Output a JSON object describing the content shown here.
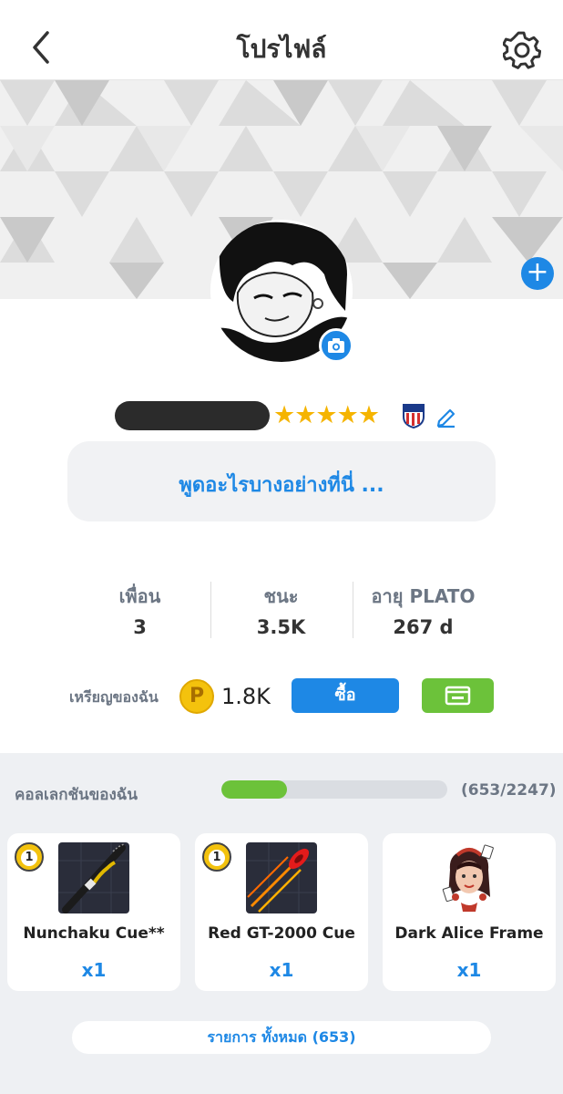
{
  "header": {
    "title": "โปรไฟล์",
    "back_icon": "chevron-left-icon",
    "settings_icon": "gear-icon"
  },
  "profile": {
    "username": "",
    "stars": "★★★★★",
    "status_placeholder": "พูดอะไรบางอย่างที่นี่ ..."
  },
  "stats": [
    {
      "label": "เพื่อน",
      "value": "3"
    },
    {
      "label": "ชนะ",
      "value": "3.5K"
    },
    {
      "label": "อายุ PLATO",
      "value": "267 d"
    }
  ],
  "coins": {
    "label": "เหรียญของฉัน",
    "coin_symbol": "P",
    "amount": "1.8K",
    "buy_label": "ซื้อ"
  },
  "collection": {
    "title": "คอลเลกชันของฉัน",
    "progress_text": "(653/2247)",
    "progress_fraction": 0.29,
    "items": [
      {
        "name": "Nunchaku Cue**",
        "quantity": "x1",
        "badge": "1"
      },
      {
        "name": "Red GT-2000 Cue",
        "quantity": "x1",
        "badge": "1"
      },
      {
        "name": "Dark Alice Frame",
        "quantity": "x1"
      }
    ],
    "view_all_label": "รายการ ทั้งหมด (653)"
  },
  "colors": {
    "accent_blue": "#1e88e5",
    "accent_green": "#6cc23a",
    "coin_gold": "#f4c20d",
    "star_gold": "#f5b400"
  }
}
